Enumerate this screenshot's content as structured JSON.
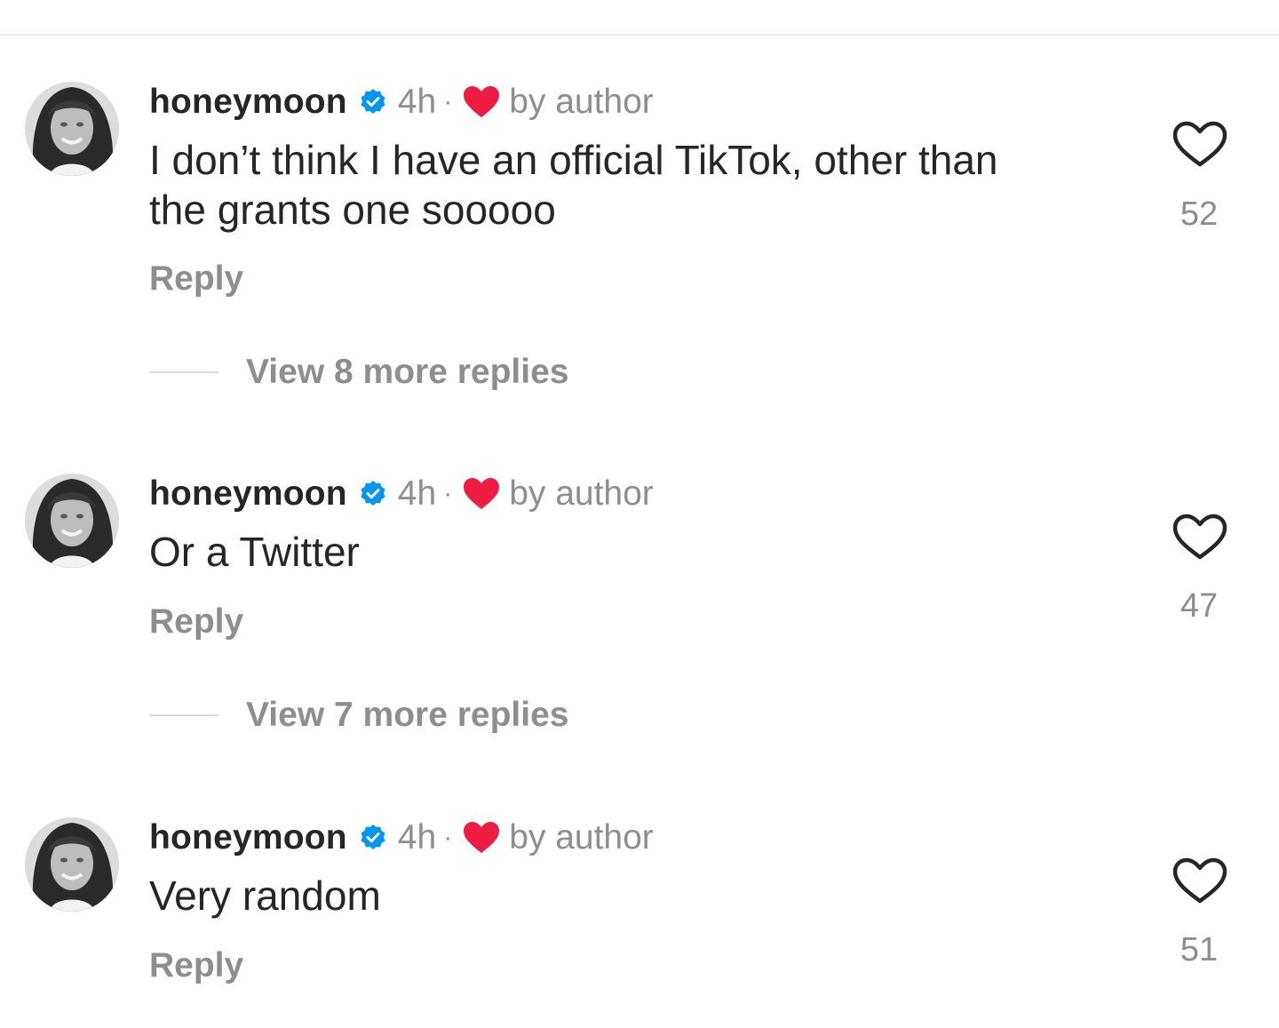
{
  "comments": [
    {
      "username": "honeymoon",
      "time": "4h",
      "separator": "·",
      "author_tag": "by author",
      "text_lines": [
        "I don’t think I have an official TikTok, other than",
        "the grants one sooooo"
      ],
      "reply_label": "Reply",
      "like_count": "52",
      "view_replies": "View 8 more replies"
    },
    {
      "username": "honeymoon",
      "time": "4h",
      "separator": "·",
      "author_tag": "by author",
      "text_lines": [
        "Or a Twitter"
      ],
      "reply_label": "Reply",
      "like_count": "47",
      "view_replies": "View 7 more replies"
    },
    {
      "username": "honeymoon",
      "time": "4h",
      "separator": "·",
      "author_tag": "by author",
      "text_lines": [
        "Very random"
      ],
      "reply_label": "Reply",
      "like_count": "51"
    }
  ],
  "icons": {
    "verified": "verified-badge-icon",
    "author_like": "red-heart-icon",
    "like": "heart-outline-icon"
  },
  "colors": {
    "verified_blue": "#0095f6",
    "heart_red": "#ed1c40",
    "secondary_text": "#8e8e8e",
    "primary_text": "#262626"
  }
}
